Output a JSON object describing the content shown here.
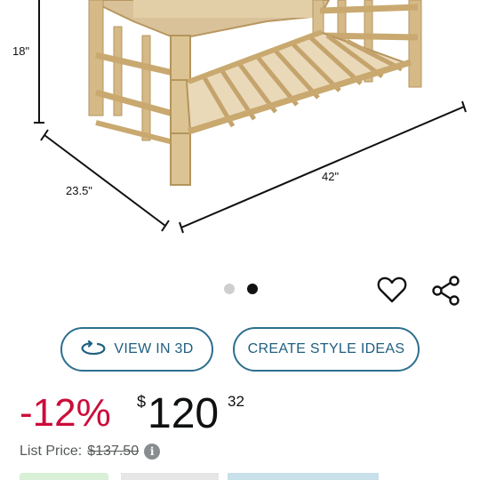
{
  "product_image": {
    "dimensions": {
      "height": "18\"",
      "depth": "23.5\"",
      "width": "42\""
    },
    "carousel": {
      "count": 2,
      "active_index": 1
    }
  },
  "actions": {
    "wishlist_icon": "heart-outline-icon",
    "share_icon": "share-icon"
  },
  "buttons": {
    "view_3d_label": "VIEW IN 3D",
    "view_3d_icon": "rotate-3d-icon",
    "style_ideas_label": "CREATE STYLE IDEAS"
  },
  "price": {
    "discount": "-12%",
    "currency": "$",
    "whole": "120",
    "fraction": "32",
    "list_price_label": "List Price:",
    "list_price_value": "$137.50",
    "discount_color": "#cc0c39"
  },
  "colors": {
    "accent": "#1f5f7f",
    "button_border": "#2d6f8f"
  }
}
